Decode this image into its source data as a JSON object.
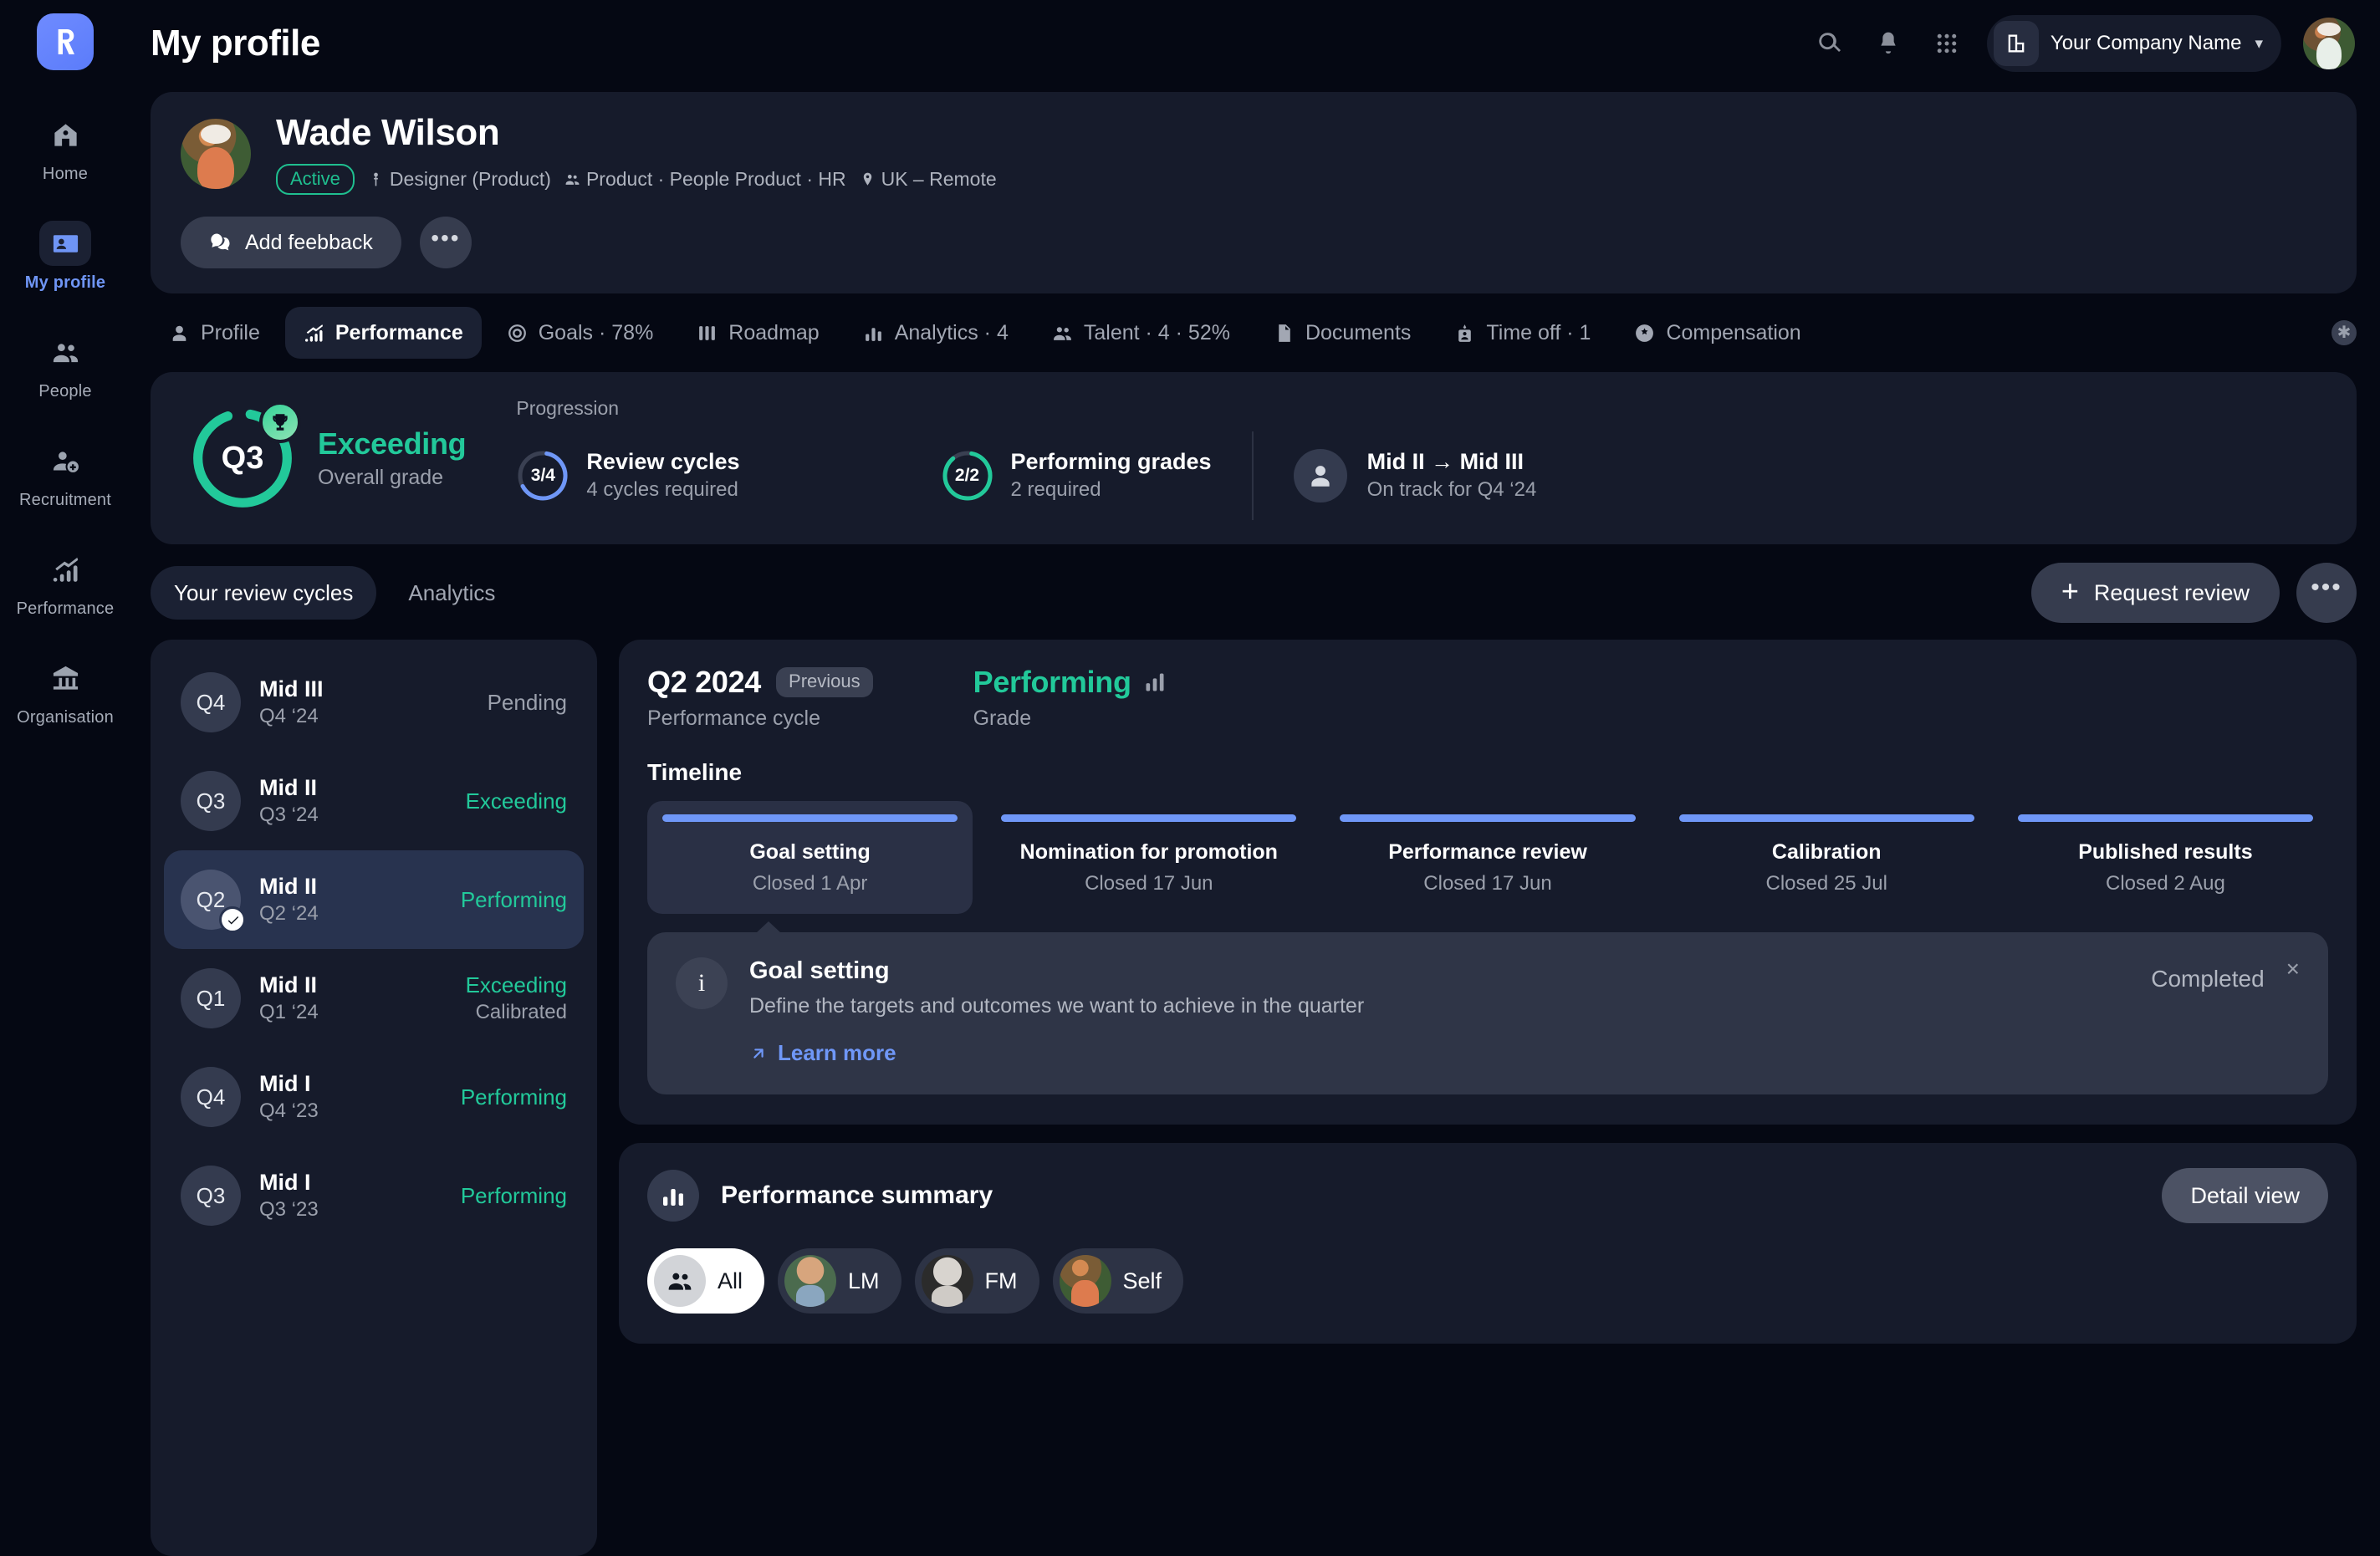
{
  "brand": {
    "logo_icon": "revolut-r-logo"
  },
  "header": {
    "title": "My profile",
    "search_icon": "search-icon",
    "bell_icon": "bell-icon",
    "apps_icon": "apps-grid-icon",
    "company_name": "Your Company Name",
    "company_icon": "building-icon",
    "chevron": "⌄",
    "avatar": "user-avatar"
  },
  "profile": {
    "name": "Wade Wilson",
    "status": "Active",
    "role": "Designer (Product)",
    "team": "Product · People Product · HR",
    "location": "UK – Remote",
    "add_feedback": "Add feebback",
    "more": "•••"
  },
  "tabs": [
    {
      "label": "Profile",
      "icon": "person-icon",
      "active": false
    },
    {
      "label": "Performance",
      "icon": "chart-up-icon",
      "active": true
    },
    {
      "label": "Goals · 78%",
      "icon": "target-icon",
      "active": false
    },
    {
      "label": "Roadmap",
      "icon": "columns-icon",
      "active": false
    },
    {
      "label": "Analytics · 4",
      "icon": "bar-chart-icon",
      "active": false
    },
    {
      "label": "Talent · 4 · 52%",
      "icon": "people-icon",
      "active": false
    },
    {
      "label": "Documents",
      "icon": "document-icon",
      "active": false
    },
    {
      "label": "Time off · 1",
      "icon": "calendar-person-icon",
      "active": false
    },
    {
      "label": "Compensation",
      "icon": "coin-icon",
      "active": false
    }
  ],
  "progression": {
    "quarter_badge": "Q3",
    "grade_title": "Exceeding",
    "grade_sub": "Overall grade",
    "trophy_icon": "trophy-icon",
    "section_label": "Progression",
    "items": [
      {
        "ratio": "3/4",
        "fraction": 0.75,
        "color": "#6f97f7",
        "title": "Review cycles",
        "sub": "4 cycles required"
      },
      {
        "ratio": "2/2",
        "fraction": 1.0,
        "color": "#22c99a",
        "title": "Performing grades",
        "sub": "2 required"
      }
    ],
    "seniority": {
      "title": "Mid II → Mid III",
      "sub": "On track for Q4 ‘24",
      "icon": "person-icon"
    }
  },
  "subtabs": [
    {
      "label": "Your review cycles",
      "active": true
    },
    {
      "label": "Analytics",
      "active": false
    }
  ],
  "actions": {
    "request_review": "Request review",
    "plus": "+",
    "more": "•••"
  },
  "cycles": [
    {
      "q": "Q4",
      "name": "Mid III",
      "period": "Q4 ‘24",
      "status": "Pending",
      "status_color": "grey",
      "sub": "",
      "selected": false
    },
    {
      "q": "Q3",
      "name": "Mid II",
      "period": "Q3 ‘24",
      "status": "Exceeding",
      "status_color": "green",
      "sub": "",
      "selected": false
    },
    {
      "q": "Q2",
      "name": "Mid II",
      "period": "Q2 ‘24",
      "status": "Performing",
      "status_color": "green",
      "sub": "",
      "selected": true
    },
    {
      "q": "Q1",
      "name": "Mid II",
      "period": "Q1 ‘24",
      "status": "Exceeding",
      "status_color": "green",
      "sub": "Calibrated",
      "selected": false
    },
    {
      "q": "Q4",
      "name": "Mid I",
      "period": "Q4 ‘23",
      "status": "Performing",
      "status_color": "green",
      "sub": "",
      "selected": false
    },
    {
      "q": "Q3",
      "name": "Mid I",
      "period": "Q3 ‘23",
      "status": "Performing",
      "status_color": "green",
      "sub": "",
      "selected": false
    }
  ],
  "detail": {
    "cycle_title": "Q2 2024",
    "chip": "Previous",
    "cycle_caption": "Performance cycle",
    "grade_value": "Performing",
    "grade_caption": "Grade",
    "grade_icon": "bar-chart-icon",
    "timeline_label": "Timeline",
    "timeline": [
      {
        "name": "Goal setting",
        "date": "Closed 1 Apr",
        "active": true
      },
      {
        "name": "Nomination for promotion",
        "date": "Closed 17 Jun",
        "active": false
      },
      {
        "name": "Performance review",
        "date": "Closed 17 Jun",
        "active": false
      },
      {
        "name": "Calibration",
        "date": "Closed 25 Jul",
        "active": false
      },
      {
        "name": "Published results",
        "date": "Closed 2 Aug",
        "active": false
      }
    ],
    "notice": {
      "icon": "info-icon",
      "title": "Goal setting",
      "description": "Define the targets and outcomes we want to achieve in the quarter",
      "link": "Learn more",
      "link_icon": "arrow-up-right-icon",
      "status": "Completed",
      "close": "×"
    }
  },
  "summary": {
    "icon": "bar-chart-icon",
    "title": "Performance summary",
    "detail_view": "Detail view",
    "filters": [
      {
        "label": "All",
        "type": "icon",
        "icon": "people-icon",
        "active": true
      },
      {
        "label": "LM",
        "type": "avatar",
        "avatar": "av-lm",
        "active": false
      },
      {
        "label": "FM",
        "type": "avatar",
        "avatar": "av-fm",
        "active": false
      },
      {
        "label": "Self",
        "type": "avatar",
        "avatar": "av-self",
        "active": false
      }
    ]
  },
  "sidebar": {
    "items": [
      {
        "label": "Home",
        "icon": "home-icon",
        "active": false
      },
      {
        "label": "My profile",
        "icon": "id-card-icon",
        "active": true
      },
      {
        "label": "People",
        "icon": "people-icon",
        "active": false
      },
      {
        "label": "Recruitment",
        "icon": "person-plus-icon",
        "active": false
      },
      {
        "label": "Performance",
        "icon": "chart-up-icon",
        "active": false
      },
      {
        "label": "Organisation",
        "icon": "bank-icon",
        "active": false
      }
    ]
  },
  "colors": {
    "accent_green": "#22c99a",
    "accent_blue": "#6f97f7",
    "card_bg": "#161b2b",
    "page_bg": "#050813"
  }
}
